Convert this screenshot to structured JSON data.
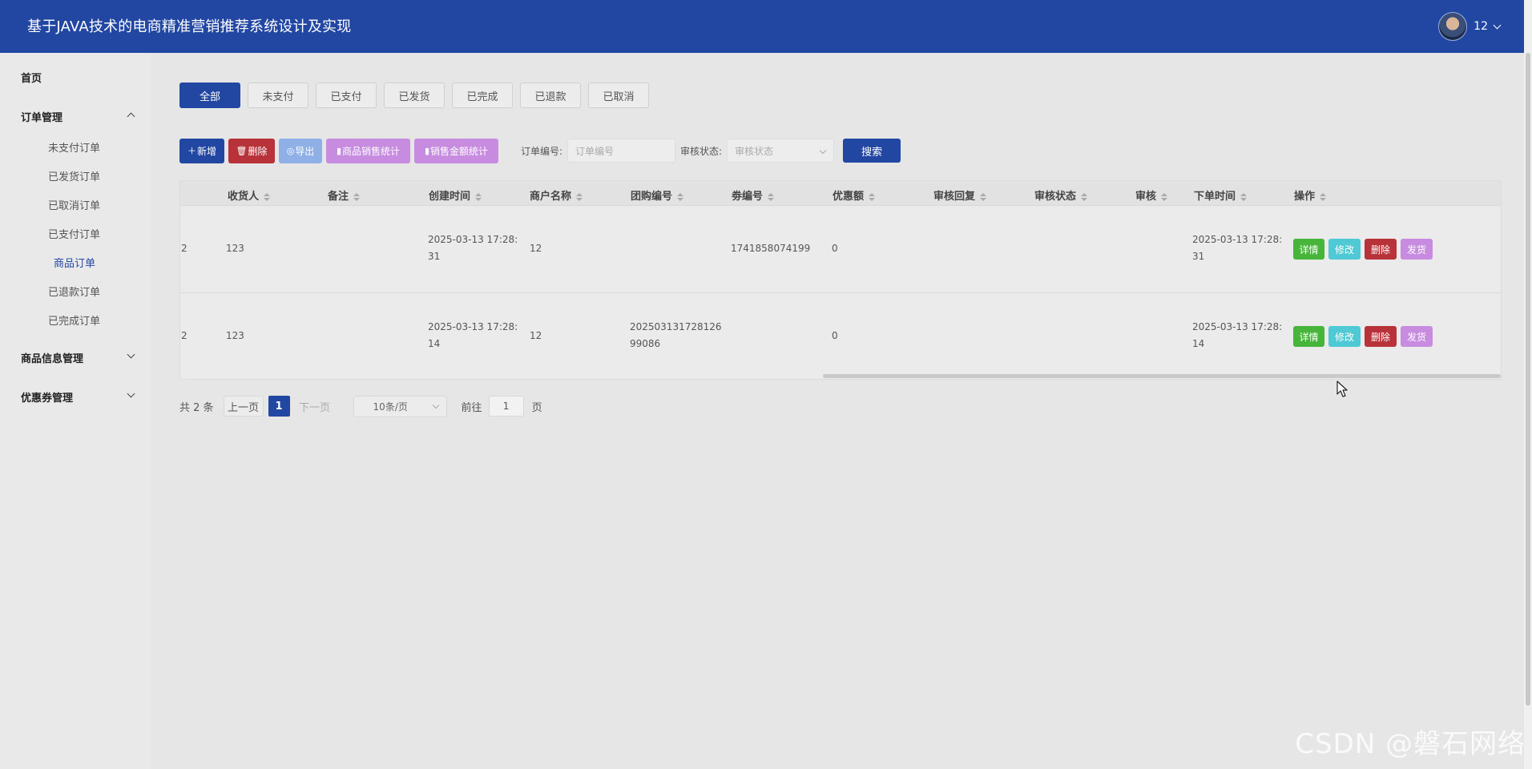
{
  "header": {
    "title": "基于JAVA技术的电商精准营销推荐系统设计及实现",
    "username": "12"
  },
  "sidebar": {
    "home": "首页",
    "groups": [
      {
        "label": "订单管理",
        "expanded": true,
        "items": [
          "未支付订单",
          "已发货订单",
          "已取消订单",
          "已支付订单",
          "商品订单",
          "已退款订单",
          "已完成订单"
        ],
        "active_item": "商品订单"
      },
      {
        "label": "商品信息管理",
        "expanded": false
      },
      {
        "label": "优惠券管理",
        "expanded": false
      }
    ]
  },
  "tabs": [
    "全部",
    "未支付",
    "已支付",
    "已发货",
    "已完成",
    "已退款",
    "已取消"
  ],
  "active_tab": "全部",
  "toolbar": {
    "add": "新增",
    "delete": "删除",
    "export": "导出",
    "product_sales_stats": "商品销售统计",
    "sales_amount_stats": "销售金额统计",
    "order_no_label": "订单编号:",
    "order_no_placeholder": "订单编号",
    "audit_status_label": "审核状态:",
    "audit_status_placeholder": "审核状态",
    "search": "搜索"
  },
  "table": {
    "columns": [
      "收货人",
      "备注",
      "创建时间",
      "商户名称",
      "团购编号",
      "劵编号",
      "优惠额",
      "审核回复",
      "审核状态",
      "审核",
      "下单时间",
      "操作"
    ],
    "rows": [
      {
        "partial": "2",
        "receiver": "123",
        "note": "",
        "created_l1": "2025-03-13 17:28:",
        "created_l2": "31",
        "merchant": "12",
        "group_l1": "",
        "group_l2": "",
        "coupon": "1741858074199",
        "discount": "0",
        "reply": "",
        "status": "",
        "audit": "",
        "order_l1": "2025-03-13 17:28:",
        "order_l2": "31"
      },
      {
        "partial": "2",
        "receiver": "123",
        "note": "",
        "created_l1": "2025-03-13 17:28:",
        "created_l2": "14",
        "merchant": "12",
        "group_l1": "202503131728126",
        "group_l2": "99086",
        "coupon": "",
        "discount": "0",
        "reply": "",
        "status": "",
        "audit": "",
        "order_l1": "2025-03-13 17:28:",
        "order_l2": "14"
      }
    ],
    "actions": [
      "详情",
      "修改",
      "删除",
      "发货"
    ]
  },
  "pagination": {
    "total": "共 2 条",
    "prev": "上一页",
    "current": "1",
    "next": "下一页",
    "page_size": "10条/页",
    "goto_label": "前往",
    "goto_value": "1",
    "page_unit": "页"
  },
  "watermark": "CSDN @磐石网络",
  "colors": {
    "primary": "#2247a3",
    "danger": "#b8323a",
    "success": "#46b53a",
    "info": "#4fc9d4",
    "purple": "#c78ce0",
    "light_blue": "#8fb0e6"
  }
}
